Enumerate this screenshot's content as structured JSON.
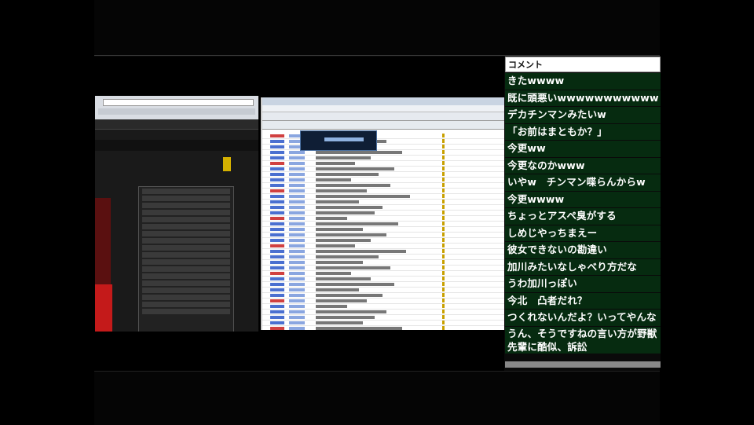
{
  "comment_panel": {
    "header": "コメント",
    "comments": [
      "きたwwww",
      "既に頭悪いwwwwwwwwwww",
      "デカチンマンみたいw",
      "「お前はまともか？」",
      "今更ww",
      "今更なのかwww",
      "いやw　チンマン喋らんからw",
      "今更wwww",
      "ちょっとアスペ臭がする",
      "しめじやっちまえー",
      "彼女できないの勘違い",
      "加川みたいなしゃべり方だな",
      "うわ加川っぽい",
      "今北　凸者だれ？",
      "つくれないんだよ？いってやんな",
      "うん、そうですねの言い方が野獣先輩に酷似、訴訟"
    ]
  },
  "colors": {
    "comment_bg": "#062b10",
    "comment_text": "#ffffff",
    "header_bg": "#ffffff",
    "stage_bg": "#000000"
  }
}
